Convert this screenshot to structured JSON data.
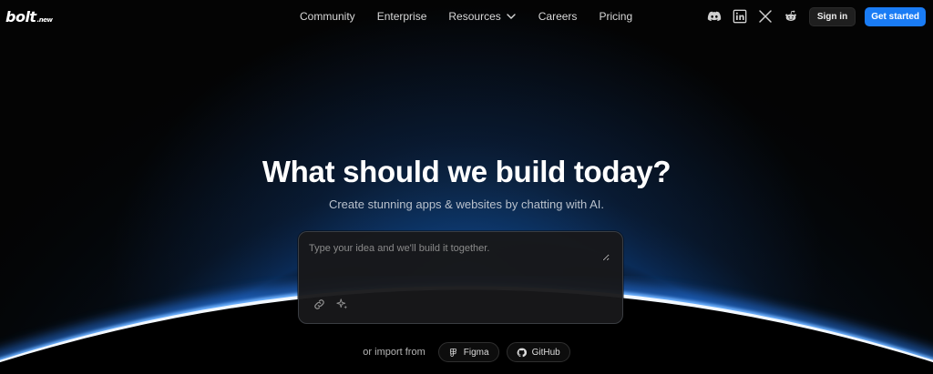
{
  "header": {
    "logo": {
      "main": "bolt",
      "suffix": ".new"
    },
    "nav": [
      {
        "label": "Community",
        "name": "nav-community"
      },
      {
        "label": "Enterprise",
        "name": "nav-enterprise"
      },
      {
        "label": "Resources",
        "name": "nav-resources",
        "dropdown": true
      },
      {
        "label": "Careers",
        "name": "nav-careers"
      },
      {
        "label": "Pricing",
        "name": "nav-pricing"
      }
    ],
    "social_icons": [
      "discord-icon",
      "linkedin-icon",
      "x-icon",
      "reddit-icon"
    ],
    "sign_in": "Sign in",
    "get_started": "Get started"
  },
  "hero": {
    "title": "What should we build today?",
    "subtitle": "Create stunning apps & websites by chatting with AI."
  },
  "prompt": {
    "placeholder": "Type your idea and we'll build it together.",
    "value": ""
  },
  "import": {
    "label": "or import from",
    "figma": "Figma",
    "github": "GitHub"
  },
  "colors": {
    "accent": "#1a7cf5",
    "background": "#040404",
    "glow": "#1e6ec8"
  }
}
